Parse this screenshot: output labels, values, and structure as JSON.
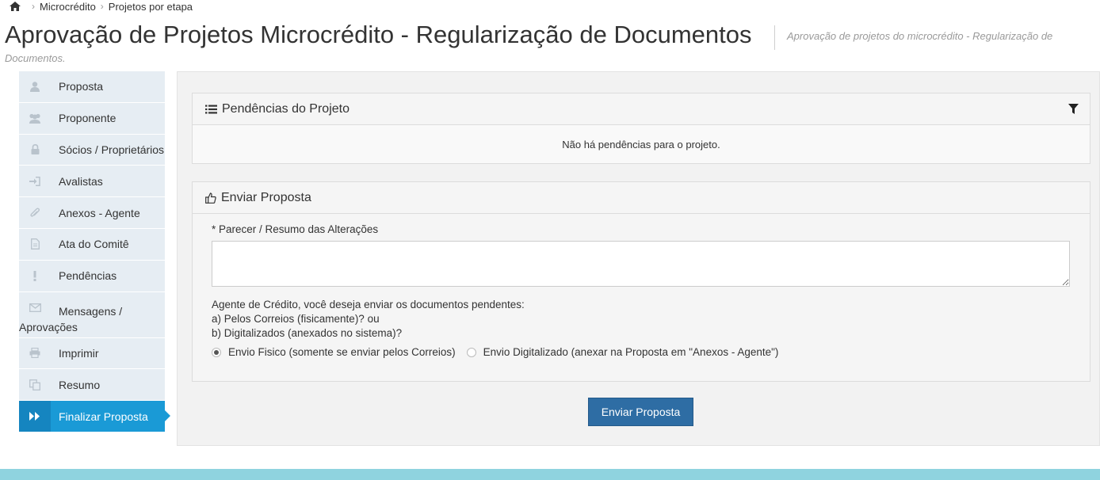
{
  "breadcrumb": {
    "home_icon": "home-icon",
    "items": [
      "Microcrédito",
      "Projetos por etapa"
    ]
  },
  "page": {
    "title": "Aprovação de Projetos Microcrédito - Regularização de Documentos",
    "subtitle_line1": "Aprovação de projetos do microcrédito - Regularização de",
    "subtitle_line2": "Documentos."
  },
  "sidebar": {
    "items": [
      {
        "label": "Proposta",
        "icon": "user-icon"
      },
      {
        "label": "Proponente",
        "icon": "users-icon"
      },
      {
        "label": "Sócios / Proprietários",
        "icon": "lock-icon"
      },
      {
        "label": "Avalistas",
        "icon": "sign-in-icon"
      },
      {
        "label": "Anexos - Agente",
        "icon": "paperclip-icon"
      },
      {
        "label": "Ata do Comitê",
        "icon": "file-icon"
      },
      {
        "label": "Pendências",
        "icon": "exclamation-icon"
      },
      {
        "label": "Mensagens /",
        "label2": "Aprovações",
        "icon": "envelope-icon"
      },
      {
        "label": "Imprimir",
        "icon": "print-icon"
      },
      {
        "label": "Resumo",
        "icon": "copy-icon"
      },
      {
        "label": "Finalizar Proposta",
        "icon": "forward-icon",
        "active": true
      }
    ]
  },
  "pendencias": {
    "title": "Pendências do Projeto",
    "empty_message": "Não há pendências para o projeto."
  },
  "enviar": {
    "title": "Enviar Proposta",
    "field_label": "* Parecer / Resumo das Alterações",
    "textarea_value": "",
    "question_line1": "Agente de Crédito, você deseja enviar os documentos pendentes:",
    "question_line2": "a) Pelos Correios (fisicamente)? ou",
    "question_line3": "b) Digitalizados (anexados no sistema)?",
    "option_fisico": "Envio Fisico (somente se enviar pelos Correios)",
    "option_digital": "Envio Digitalizado (anexar na Proposta em \"Anexos - Agente\")",
    "selected": "fisico",
    "submit_label": "Enviar Proposta"
  },
  "colors": {
    "accent": "#1a9ad6",
    "button": "#2e6da4",
    "footer": "#8fd3df"
  }
}
